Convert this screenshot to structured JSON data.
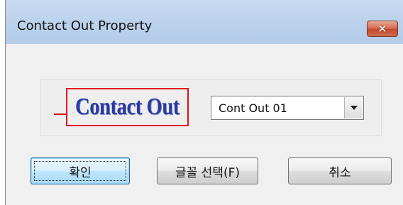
{
  "window": {
    "title": "Contact Out Property",
    "close_label": "✕"
  },
  "preview": {
    "text": "Contact Out",
    "colors": {
      "frame": "#e0111c",
      "text": "#2a3aa2"
    }
  },
  "style_select": {
    "value": "Cont Out 01"
  },
  "buttons": {
    "ok": "확인",
    "font_select": "글꼴 선택(F)",
    "cancel": "취소"
  }
}
